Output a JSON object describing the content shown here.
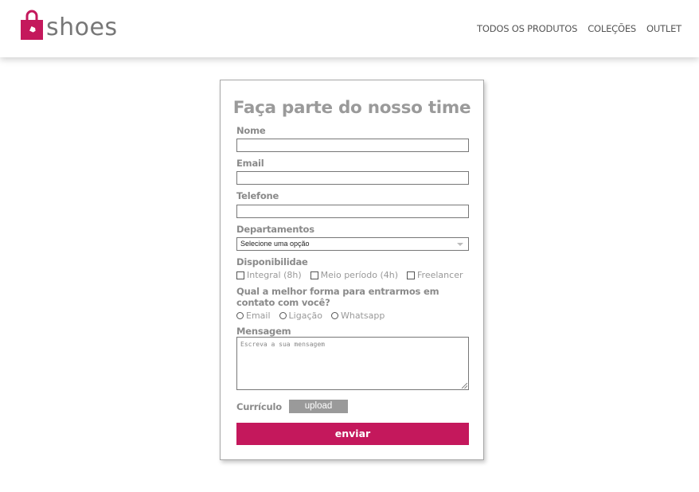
{
  "header": {
    "logo_text": "shoes",
    "logo_icon": "shopping-bag-icon",
    "nav": [
      {
        "label": "TODOS OS PRODUTOS"
      },
      {
        "label": "COLEÇÕES"
      },
      {
        "label": "OUTLET"
      }
    ]
  },
  "form": {
    "title": "Faça parte do nosso time",
    "nome_label": "Nome",
    "nome_value": "",
    "email_label": "Email",
    "email_value": "",
    "telefone_label": "Telefone",
    "telefone_value": "",
    "departamentos_label": "Departamentos",
    "departamentos_selected": "Selecione uma opção",
    "disponibilidade_label": "Disponibilidae",
    "disponibilidade_options": [
      {
        "label": "Integral (8h)",
        "checked": false
      },
      {
        "label": "Meio período (4h)",
        "checked": false
      },
      {
        "label": "Freelancer",
        "checked": false
      }
    ],
    "contato_label": "Qual a melhor forma para entrarmos em contato com você?",
    "contato_options": [
      {
        "label": "Email",
        "selected": false
      },
      {
        "label": "Ligação",
        "selected": false
      },
      {
        "label": "Whatsapp",
        "selected": false
      }
    ],
    "mensagem_label": "Mensagem",
    "mensagem_placeholder": "Escreva a sua mensagem",
    "curriculo_label": "Currículo",
    "upload_label": "upload",
    "submit_label": "enviar"
  },
  "colors": {
    "brand": "#c4185c",
    "upload_button": "#9a9a9a",
    "label_text": "#8a8a8a"
  }
}
